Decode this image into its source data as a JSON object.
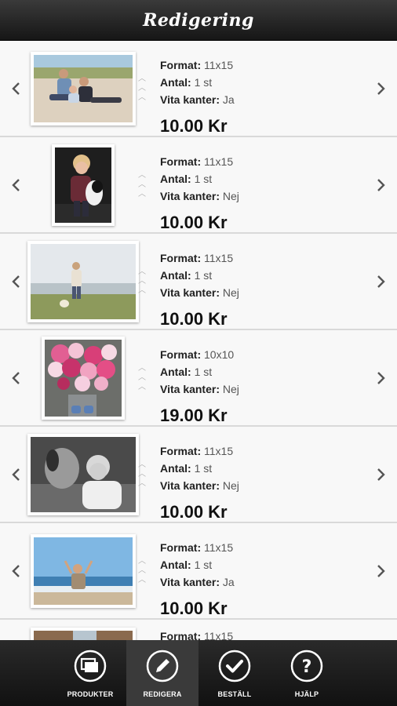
{
  "header": {
    "title": "Redigering"
  },
  "labels": {
    "format": "Format:",
    "antal": "Antal:",
    "vita": "Vita kanter:"
  },
  "rows": [
    {
      "format": "11x15",
      "antal": "1 st",
      "vita": "Ja",
      "price": "10.00 Kr"
    },
    {
      "format": "11x15",
      "antal": "1 st",
      "vita": "Nej",
      "price": "10.00 Kr"
    },
    {
      "format": "11x15",
      "antal": "1 st",
      "vita": "Nej",
      "price": "10.00 Kr"
    },
    {
      "format": "10x10",
      "antal": "1 st",
      "vita": "Nej",
      "price": "19.00 Kr"
    },
    {
      "format": "11x15",
      "antal": "1 st",
      "vita": "Nej",
      "price": "10.00 Kr"
    },
    {
      "format": "11x15",
      "antal": "1 st",
      "vita": "Ja",
      "price": "10.00 Kr"
    },
    {
      "format": "11x15",
      "antal": "",
      "vita": "",
      "price": ""
    }
  ],
  "tabs": [
    {
      "label": "PRODUKTER",
      "icon": "stack-icon"
    },
    {
      "label": "REDIGERA",
      "icon": "pencil-icon"
    },
    {
      "label": "BESTÄLL",
      "icon": "checkmark-icon"
    },
    {
      "label": "HJÄLP",
      "icon": "question-icon"
    }
  ]
}
